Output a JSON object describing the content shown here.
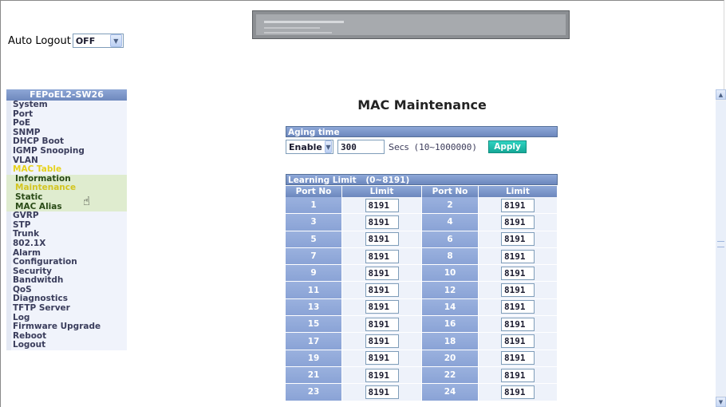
{
  "header": {
    "auto_logout_label": "Auto Logout",
    "auto_logout_value": "OFF"
  },
  "sidebar": {
    "title": "FEPoEL2-SW26",
    "items": [
      {
        "label": "System"
      },
      {
        "label": "Port"
      },
      {
        "label": "PoE"
      },
      {
        "label": "SNMP"
      },
      {
        "label": "DHCP Boot"
      },
      {
        "label": "IGMP Snooping"
      },
      {
        "label": "VLAN"
      },
      {
        "label": "MAC Table",
        "active": true
      },
      {
        "label": "Information",
        "sub": true
      },
      {
        "label": "Maintenance",
        "sub": true,
        "active": true
      },
      {
        "label": "Static",
        "sub": true
      },
      {
        "label": "MAC Alias",
        "sub": true
      },
      {
        "label": "GVRP"
      },
      {
        "label": "STP"
      },
      {
        "label": "Trunk"
      },
      {
        "label": "802.1X"
      },
      {
        "label": "Alarm"
      },
      {
        "label": "Configuration"
      },
      {
        "label": "Security"
      },
      {
        "label": "Bandwitdh"
      },
      {
        "label": "QoS"
      },
      {
        "label": "Diagnostics"
      },
      {
        "label": "TFTP Server"
      },
      {
        "label": "Log"
      },
      {
        "label": "Firmware Upgrade"
      },
      {
        "label": "Reboot"
      },
      {
        "label": "Logout"
      }
    ]
  },
  "main": {
    "title": "MAC Maintenance",
    "aging": {
      "header": "Aging time",
      "mode": "Enable",
      "value": "300",
      "unit": "Secs",
      "range": "(10~1000000)",
      "apply_label": "Apply"
    },
    "learning": {
      "header": "Learning Limit",
      "range": "(0~8191)",
      "columns": [
        "Port No",
        "Limit",
        "Port No",
        "Limit"
      ],
      "rows": [
        [
          "1",
          "8191",
          "2",
          "8191"
        ],
        [
          "3",
          "8191",
          "4",
          "8191"
        ],
        [
          "5",
          "8191",
          "6",
          "8191"
        ],
        [
          "7",
          "8191",
          "8",
          "8191"
        ],
        [
          "9",
          "8191",
          "10",
          "8191"
        ],
        [
          "11",
          "8191",
          "12",
          "8191"
        ],
        [
          "13",
          "8191",
          "14",
          "8191"
        ],
        [
          "15",
          "8191",
          "16",
          "8191"
        ],
        [
          "17",
          "8191",
          "18",
          "8191"
        ],
        [
          "19",
          "8191",
          "20",
          "8191"
        ],
        [
          "21",
          "8191",
          "22",
          "8191"
        ],
        [
          "23",
          "8191",
          "24",
          "8191"
        ]
      ]
    }
  },
  "colors": {
    "header_bar": "#7f98cb",
    "port_cell": "#94acdc",
    "apply_button": "#22bfae",
    "active_nav": "#e6d21c"
  }
}
